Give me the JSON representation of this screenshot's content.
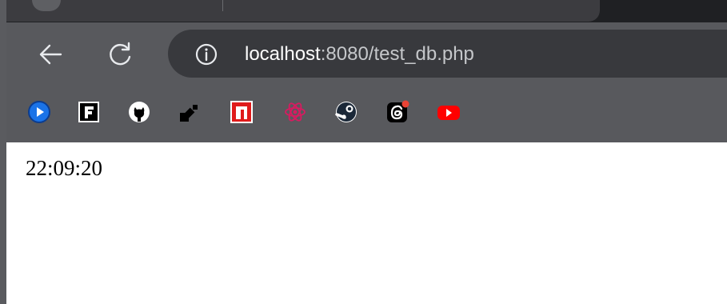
{
  "colors": {
    "chrome_dark": "#1f2023",
    "toolbar": "#58595d",
    "omnibox": "#38393d",
    "url_host": "#ffffff",
    "url_path": "#c5c7ca",
    "page_background": "#ffffff"
  },
  "toolbar": {
    "back_icon": "arrow-left-icon",
    "reload_icon": "reload-icon",
    "site_info_icon": "info-icon"
  },
  "address_bar": {
    "host": "localhost",
    "rest": ":8080/test_db.php"
  },
  "bookmarks": [
    {
      "icon": "blue-play-circle-icon"
    },
    {
      "icon": "f-box-icon"
    },
    {
      "icon": "github-icon"
    },
    {
      "icon": "black-pipe-icon"
    },
    {
      "icon": "red-n-box-icon"
    },
    {
      "icon": "react-atom-icon"
    },
    {
      "icon": "steam-icon"
    },
    {
      "icon": "threads-icon"
    },
    {
      "icon": "youtube-icon"
    }
  ],
  "page": {
    "time_text": "22:09:20"
  }
}
